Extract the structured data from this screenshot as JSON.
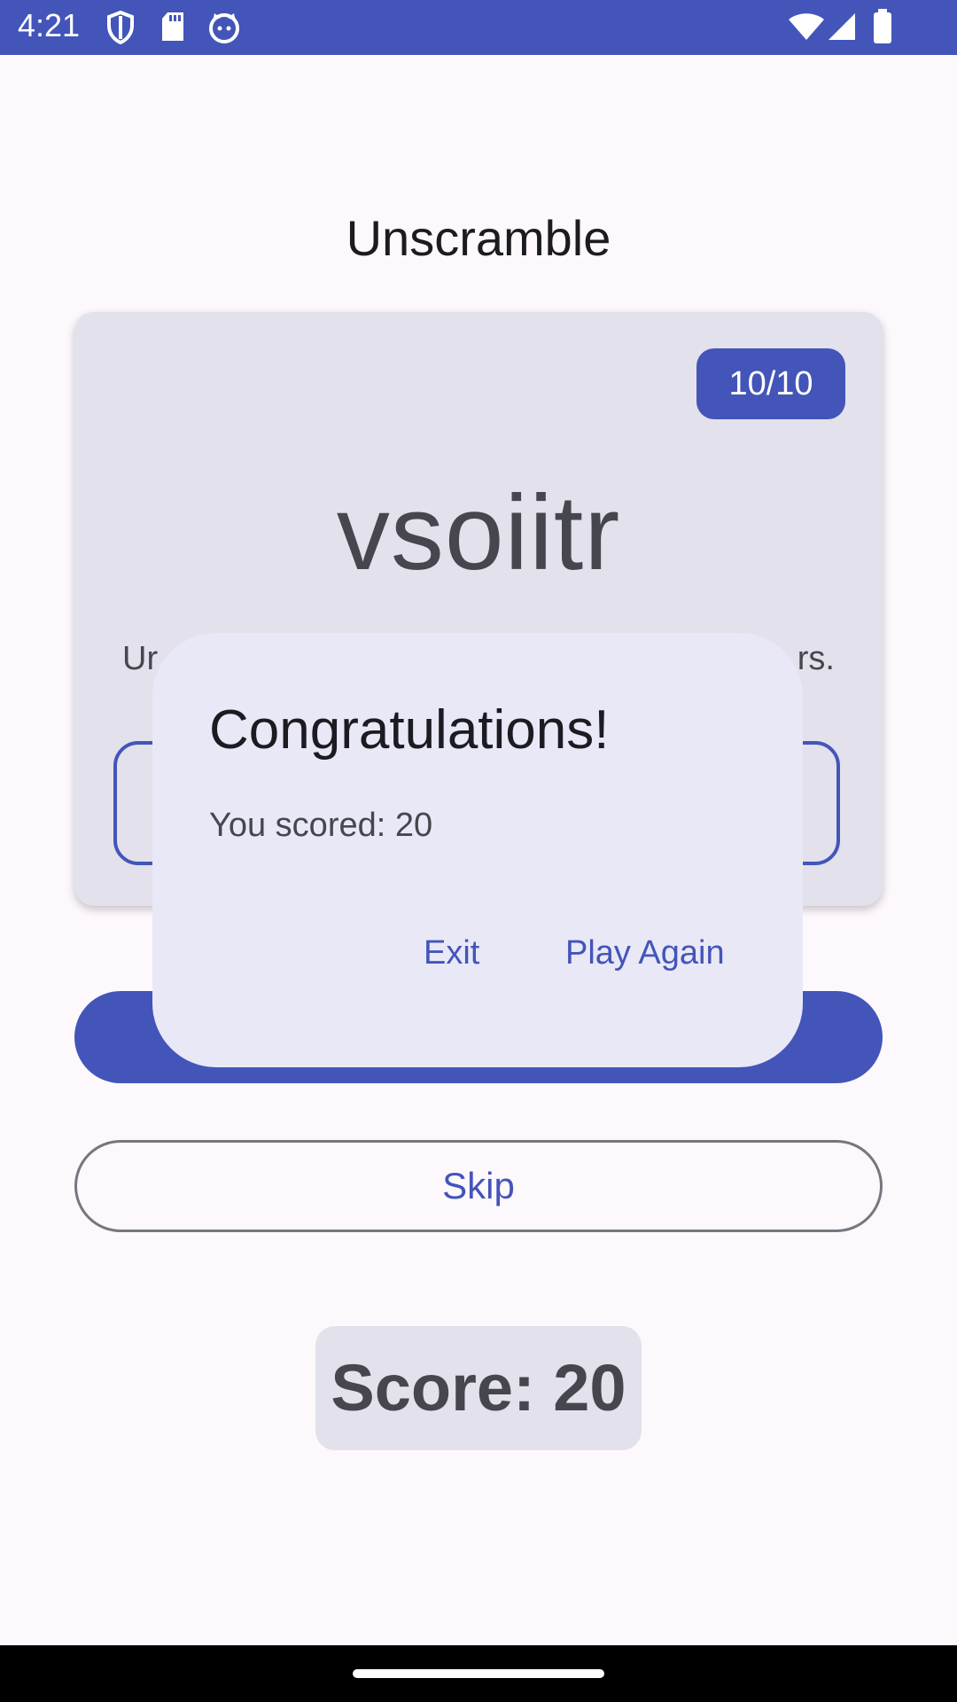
{
  "status_bar": {
    "time": "4:21",
    "icons": [
      "shield-icon",
      "sd-card-icon",
      "cat-face-icon",
      "wifi-icon",
      "cellular-signal-icon",
      "battery-icon"
    ]
  },
  "app": {
    "title": "Unscramble",
    "word_count": "10/10",
    "scrambled_word": "vsoiitr",
    "instructions_start": "Ur",
    "instructions_end": "rs.",
    "skip_label": "Skip",
    "score_label": "Score: 20"
  },
  "dialog": {
    "title": "Congratulations!",
    "text": "You scored: 20",
    "exit_label": "Exit",
    "play_again_label": "Play Again"
  },
  "colors": {
    "primary": "#4355b9",
    "card": "#e2e1ec",
    "dialog": "#e9e8f6",
    "background": "#fdf8fc"
  }
}
